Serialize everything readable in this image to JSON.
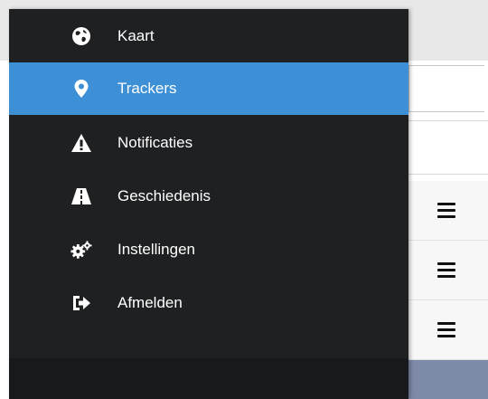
{
  "sidebar": {
    "items": [
      {
        "label": "Kaart",
        "icon": "globe-icon",
        "active": false
      },
      {
        "label": "Trackers",
        "icon": "map-marker-icon",
        "active": true
      },
      {
        "label": "Notificaties",
        "icon": "warning-icon",
        "active": false
      },
      {
        "label": "Geschiedenis",
        "icon": "road-icon",
        "active": false
      },
      {
        "label": "Instellingen",
        "icon": "gears-icon",
        "active": false
      },
      {
        "label": "Afmelden",
        "icon": "sign-out-icon",
        "active": false
      }
    ]
  },
  "colors": {
    "sidebar_bg": "#1e2022",
    "active_bg": "#3d8fd6",
    "text": "#ffffff"
  },
  "page": {
    "rows": [
      {
        "icon": "hamburger-menu-icon"
      },
      {
        "icon": "hamburger-menu-icon"
      },
      {
        "icon": "hamburger-menu-icon"
      }
    ]
  }
}
